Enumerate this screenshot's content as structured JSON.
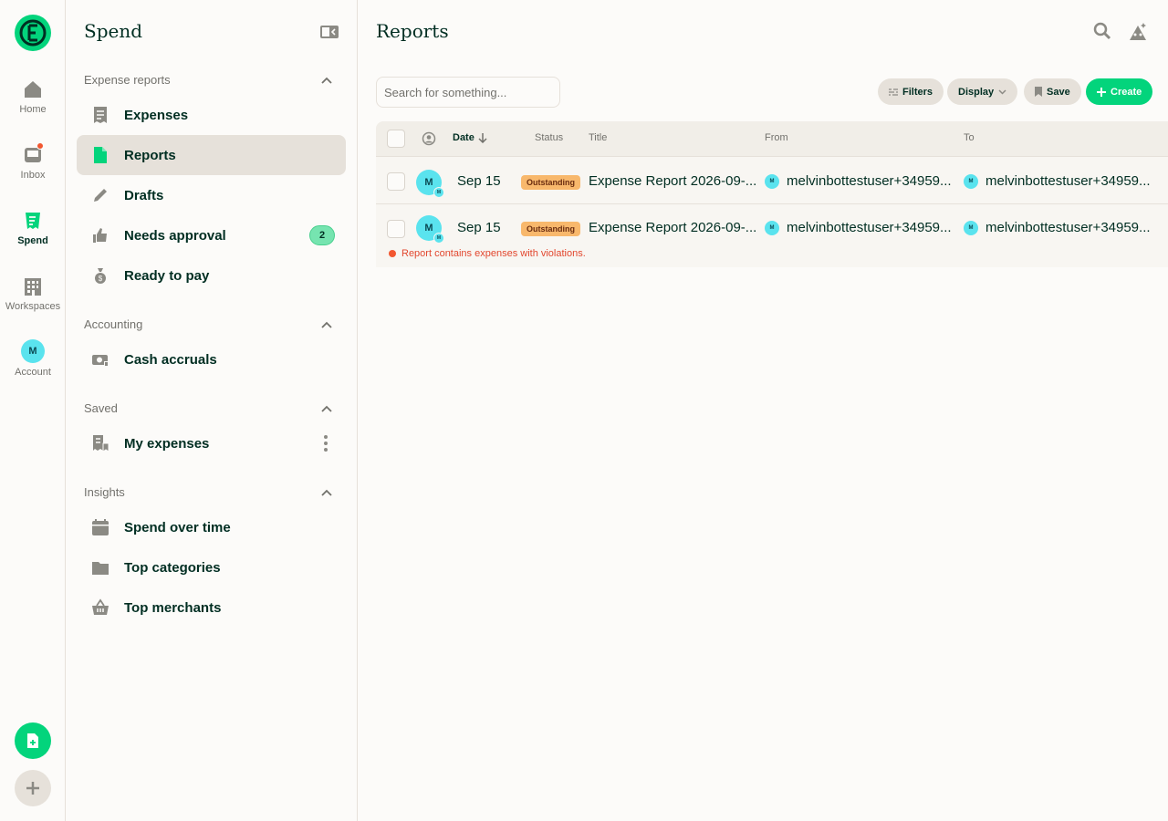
{
  "rail": {
    "items": [
      {
        "label": "Home"
      },
      {
        "label": "Inbox"
      },
      {
        "label": "Spend"
      },
      {
        "label": "Workspaces"
      },
      {
        "label": "Account",
        "avatar": "M"
      }
    ]
  },
  "sidebar": {
    "title": "Spend",
    "sections": [
      {
        "label": "Expense reports"
      },
      {
        "label": "Accounting"
      },
      {
        "label": "Saved"
      },
      {
        "label": "Insights"
      }
    ],
    "items": {
      "expenses": "Expenses",
      "reports": "Reports",
      "drafts": "Drafts",
      "needs_approval": "Needs approval",
      "needs_approval_count": "2",
      "ready_to_pay": "Ready to pay",
      "cash_accruals": "Cash accruals",
      "my_expenses": "My expenses",
      "spend_over_time": "Spend over time",
      "top_categories": "Top categories",
      "top_merchants": "Top merchants"
    }
  },
  "main": {
    "title": "Reports",
    "search_placeholder": "Search for something...",
    "buttons": {
      "filters": "Filters",
      "display": "Display",
      "save": "Save",
      "create": "Create"
    },
    "columns": {
      "date": "Date",
      "status": "Status",
      "title": "Title",
      "from": "From",
      "to": "To"
    },
    "rows": [
      {
        "avatar": "M",
        "date": "Sep 15",
        "status": "Outstanding",
        "title": "Expense Report 2026-09-...",
        "from": "melvinbottestuser+34959...",
        "to": "melvinbottestuser+34959..."
      },
      {
        "avatar": "M",
        "date": "Sep 15",
        "status": "Outstanding",
        "title": "Expense Report 2026-09-...",
        "from": "melvinbottestuser+34959...",
        "to": "melvinbottestuser+34959...",
        "violation": "Report contains expenses with violations."
      }
    ]
  },
  "colors": {
    "brand": "#03d47c",
    "accent_cyan": "#5ae3ee",
    "status_outstanding": "#f8b86c",
    "danger": "#f25730"
  }
}
